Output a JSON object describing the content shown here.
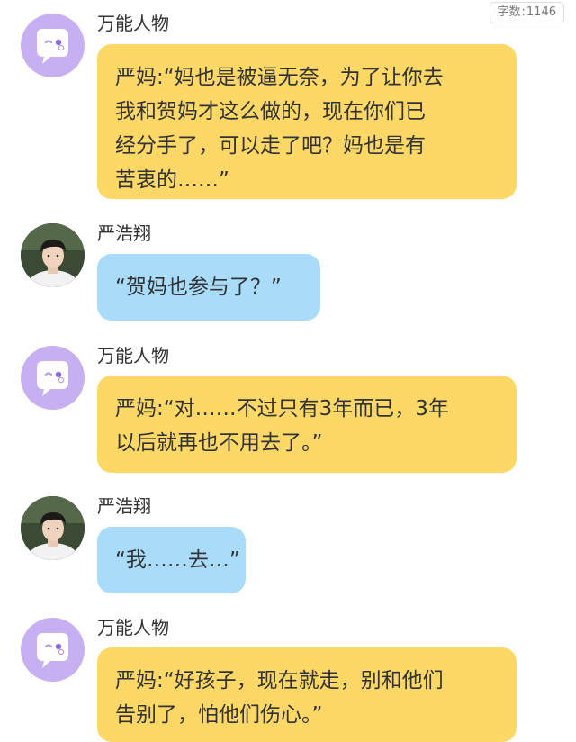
{
  "header": {
    "word_count_label": "字数",
    "word_count_sep": ":",
    "word_count_value": "1146"
  },
  "colors": {
    "bot_bubble": "#fdd866",
    "user_bubble": "#a9dcfb",
    "bot_avatar": "#c7b0f2"
  },
  "messages": [
    {
      "sender": "万能人物",
      "avatar": "bot-chat-icon",
      "lines": [
        "严妈:“妈也是被逼无奈，为了让你去",
        "我和贺妈才这么做的，现在你们已",
        "经分手了，可以走了吧？妈也是有",
        "苦衷的……”"
      ]
    },
    {
      "sender": "严浩翔",
      "avatar": "user-photo",
      "lines": [
        "“贺妈也参与了？”"
      ]
    },
    {
      "sender": "万能人物",
      "avatar": "bot-chat-icon",
      "lines": [
        "严妈:“对……不过只有3年而已，3年",
        "以后就再也不用去了。”"
      ]
    },
    {
      "sender": "严浩翔",
      "avatar": "user-photo",
      "lines": [
        "“我……去…”"
      ]
    },
    {
      "sender": "万能人物",
      "avatar": "bot-chat-icon",
      "lines": [
        "严妈:“好孩子，现在就走，别和他们",
        "告别了，怕他们伤心。”"
      ]
    }
  ]
}
